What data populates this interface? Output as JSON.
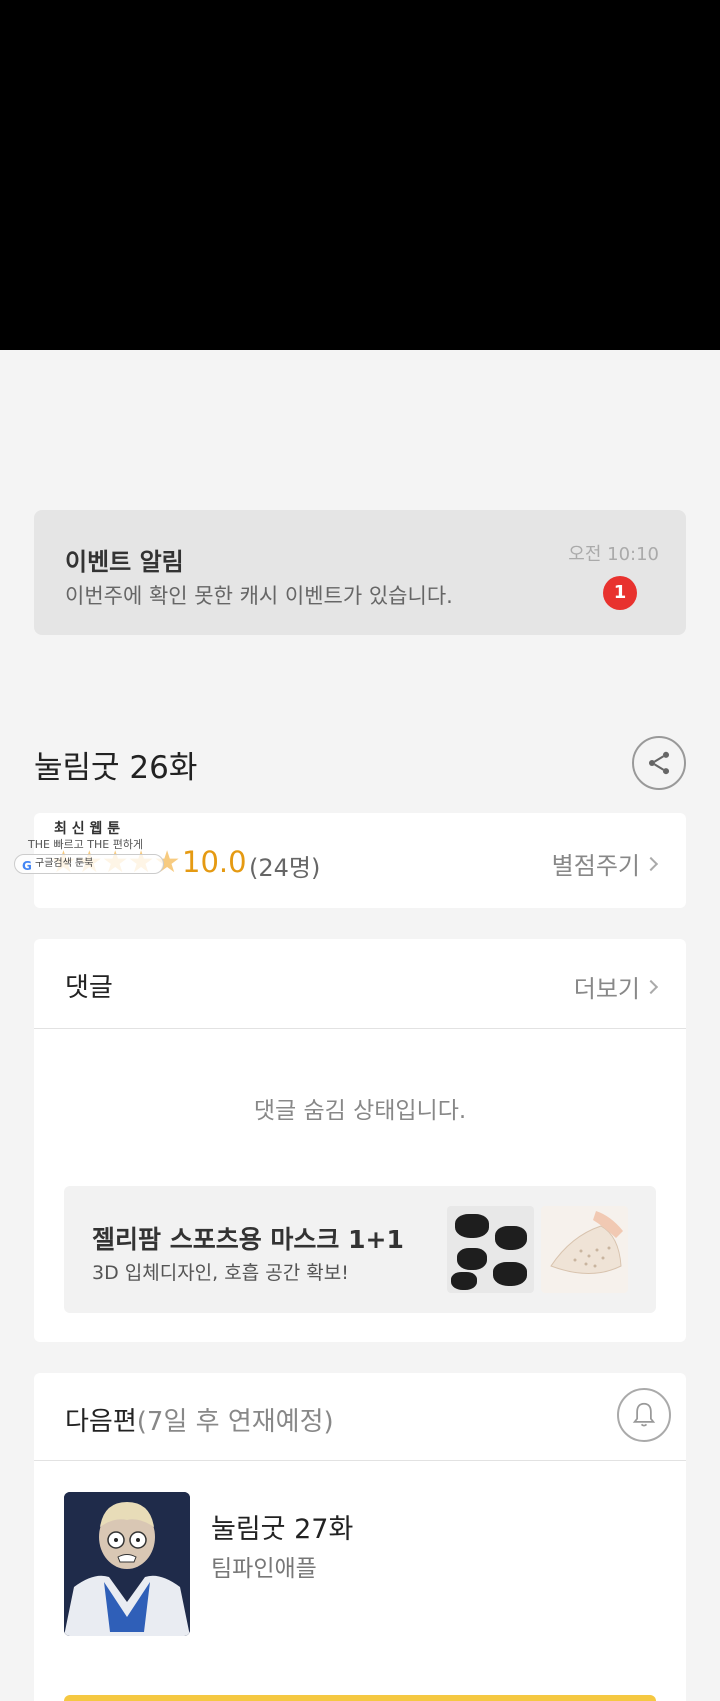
{
  "event": {
    "title": "이벤트 알림",
    "body": "이번주에 확인 못한 캐시 이벤트가 있습니다.",
    "time": "오전 10:10",
    "badge": "1"
  },
  "episode": {
    "title": "눌림굿 26화"
  },
  "rating": {
    "stars": "★★★★★",
    "score": "10.0",
    "count": "(24명)",
    "rate_label": "별점주기",
    "rating_out_of_5": 5
  },
  "overlay": {
    "line1": "최 신 웹 툰",
    "line2": "THE 빠르고 THE 편하게",
    "pill": "구글검색   툰북"
  },
  "comments": {
    "heading": "댓글",
    "more_label": "더보기",
    "hidden_message": "댓글 숨김 상태입니다."
  },
  "ad": {
    "title": "젤리팜 스포츠용 마스크 1+1",
    "subtitle": "3D 입체디자인, 호흡 공간 확보!"
  },
  "next": {
    "heading": "다음편",
    "schedule": "(7일 후 연재예정)",
    "episode_title": "눌림굿 27화",
    "author": "팀파인애플"
  },
  "colors": {
    "accent_star": "#f2a11a",
    "badge_red": "#e8322e",
    "button_yellow": "#f5c841"
  }
}
